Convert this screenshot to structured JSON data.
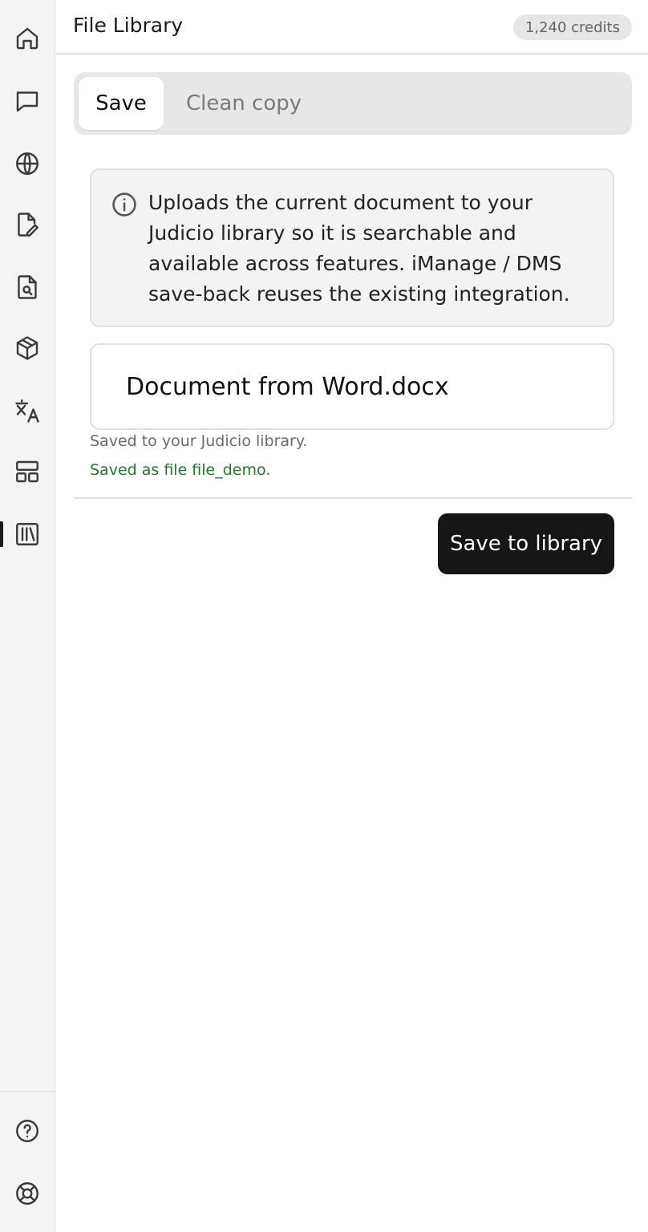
{
  "sidebar": {
    "items": [
      {
        "name": "home",
        "icon": "home-icon",
        "active": false
      },
      {
        "name": "chat",
        "icon": "chat-bubble-icon",
        "active": false
      },
      {
        "name": "web",
        "icon": "globe-icon",
        "active": false
      },
      {
        "name": "draft",
        "icon": "file-pen-icon",
        "active": false
      },
      {
        "name": "review",
        "icon": "file-search-icon",
        "active": false
      },
      {
        "name": "models",
        "icon": "cube-icon",
        "active": false
      },
      {
        "name": "translate",
        "icon": "translate-icon",
        "active": false
      },
      {
        "name": "templates",
        "icon": "layout-icon",
        "active": false
      },
      {
        "name": "library",
        "icon": "library-icon",
        "active": true
      }
    ],
    "footer": [
      {
        "name": "help",
        "icon": "help-circle-icon"
      },
      {
        "name": "support",
        "icon": "life-buoy-icon"
      }
    ]
  },
  "header": {
    "title": "File Library",
    "credits": "1,240 credits"
  },
  "tabs": [
    {
      "label": "Save",
      "active": true
    },
    {
      "label": "Clean copy",
      "active": false
    }
  ],
  "info": {
    "text": "Uploads the current document to your Judicio library so it is searchable and available across features. iManage / DMS save-back reuses the existing integration."
  },
  "form": {
    "filename": "Document from Word.docx",
    "hint": "Saved to your Judicio library.",
    "success": "Saved as file file_demo."
  },
  "actions": {
    "save_label": "Save to library"
  },
  "colors": {
    "sidebar_bg": "#f4f4f4",
    "primary_button": "#161616",
    "success_text": "#1f7a2e"
  }
}
